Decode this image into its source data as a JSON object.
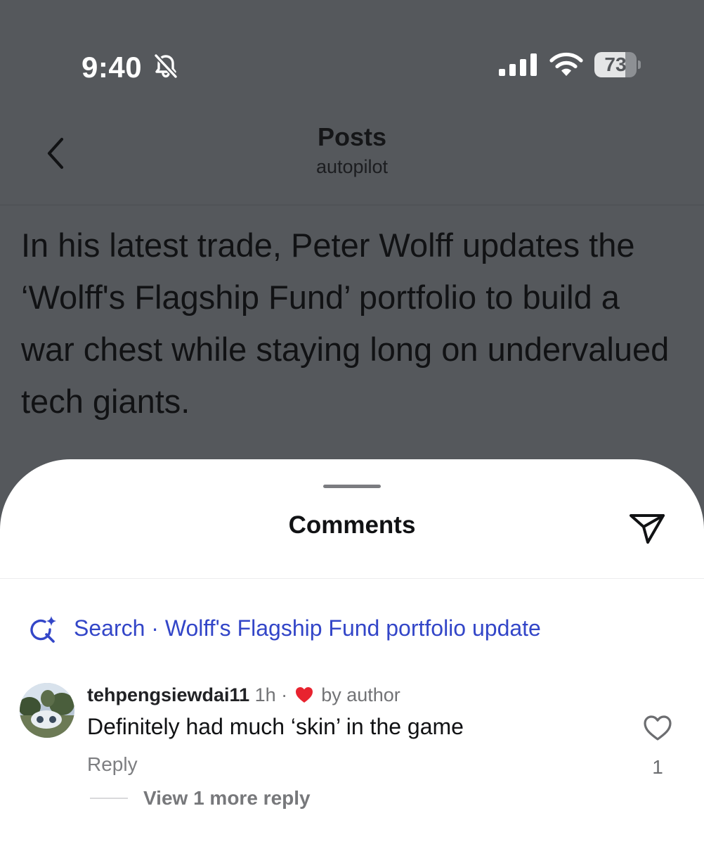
{
  "status_bar": {
    "time": "9:40",
    "battery_level": "73",
    "battery_fraction": 0.73,
    "icons": [
      "bell-slash-icon",
      "cellular-signal-icon",
      "wifi-icon",
      "battery-icon"
    ]
  },
  "header": {
    "title": "Posts",
    "subtitle": "autopilot",
    "back_icon": "chevron-left-icon"
  },
  "post": {
    "text": "In his latest trade, Peter Wolff updates the ‘Wolff's Flagship Fund’ portfolio to build a war chest while staying long on undervalued tech giants."
  },
  "comments_sheet": {
    "title": "Comments",
    "share_icon": "paper-plane-icon",
    "search": {
      "icon": "sparkle-search-icon",
      "text": "Search · Wolff's Flagship Fund portfolio update"
    },
    "comments": [
      {
        "username": "tehpengsiewdai11",
        "time": "1h",
        "separator": "·",
        "liked_by_author": "by author",
        "body": "Definitely had much ‘skin’ in the game",
        "reply_label": "Reply",
        "like_count": "1",
        "view_replies": "View 1 more reply"
      }
    ]
  },
  "colors": {
    "dim_background": "#55585c",
    "link_blue": "#3346c8",
    "heart_red": "#e8232f"
  }
}
